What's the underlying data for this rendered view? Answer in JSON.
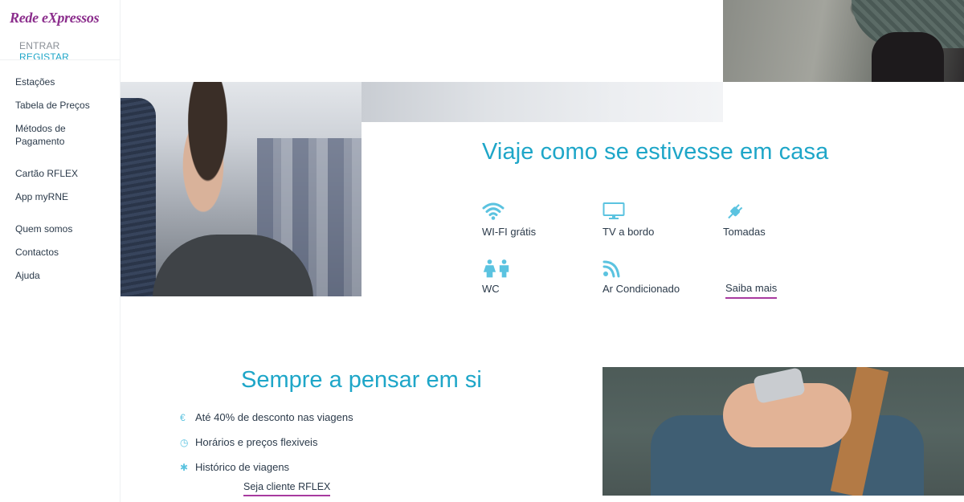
{
  "brand": {
    "logo": "Rede eXpressos"
  },
  "auth": {
    "login": "ENTRAR",
    "register": "REGISTAR"
  },
  "nav": {
    "group1": [
      "Estações",
      "Tabela de Preços",
      "Métodos de Pagamento"
    ],
    "group2": [
      "Cartão RFLEX",
      "App myRNE"
    ],
    "group3": [
      "Quem somos",
      "Contactos",
      "Ajuda"
    ]
  },
  "comfort": {
    "title": "Viaje como se estivesse em casa",
    "features": [
      {
        "label": "WI-FI grátis",
        "icon": "wifi-icon"
      },
      {
        "label": "TV a bordo",
        "icon": "tv-icon"
      },
      {
        "label": "Tomadas",
        "icon": "plug-icon"
      },
      {
        "label": "WC",
        "icon": "wc-icon"
      },
      {
        "label": "Ar Condicionado",
        "icon": "air-conditioning-icon"
      }
    ],
    "more_link": "Saiba mais"
  },
  "loyalty": {
    "title": "Sempre a pensar em si",
    "benefits": [
      {
        "icon": "euro-icon",
        "glyph": "€",
        "text": "Até 40% de desconto nas viagens"
      },
      {
        "icon": "clock-icon",
        "glyph": "◷",
        "text": "Horários e preços flexiveis"
      },
      {
        "icon": "history-icon",
        "glyph": "✱",
        "text": "Histórico de viagens"
      }
    ],
    "cta": "Seja cliente RFLEX"
  },
  "colors": {
    "accent": "#1ea6c8",
    "brand": "#8b2d8c",
    "underline": "#a83a9f",
    "icon": "#5bc3e0"
  }
}
